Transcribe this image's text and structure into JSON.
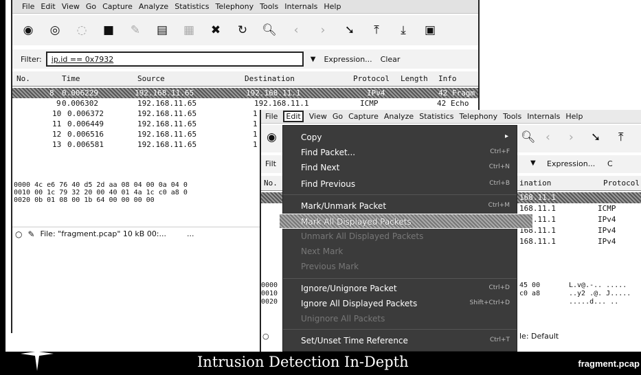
{
  "window1": {
    "menu": [
      "File",
      "Edit",
      "View",
      "Go",
      "Capture",
      "Analyze",
      "Statistics",
      "Telephony",
      "Tools",
      "Internals",
      "Help"
    ],
    "toolbar_icons": [
      "interface-icon",
      "start-capture-icon",
      "restart-icon",
      "stop-icon",
      "options-icon",
      "open-file-icon",
      "save-file-icon",
      "close-file-icon",
      "reload-icon",
      "find-icon",
      "go-back-icon",
      "go-forward-icon",
      "go-to-packet-icon",
      "first-packet-icon",
      "last-packet-icon",
      "colorize-icon"
    ],
    "filter": {
      "label": "Filter:",
      "value": "ip.id == 0x7932",
      "expression": "Expression...",
      "clear": "Clear"
    },
    "columns": [
      "No.",
      "Time",
      "Source",
      "Destination",
      "Protocol",
      "Length",
      "Info"
    ],
    "rows": [
      {
        "no": "8",
        "time": "0.006229",
        "source": "192.168.11.65",
        "dest": "192.168.11.1",
        "proto": "IPv4",
        "len": "42",
        "info": "Fragm"
      },
      {
        "no": "9",
        "time": "0.006302",
        "source": "192.168.11.65",
        "dest": "192.168.11.1",
        "proto": "ICMP",
        "len": "42",
        "info": "Echo"
      },
      {
        "no": "10",
        "time": "0.006372",
        "source": "192.168.11.65",
        "dest": "1",
        "proto": "",
        "len": "",
        "info": ""
      },
      {
        "no": "11",
        "time": "0.006449",
        "source": "192.168.11.65",
        "dest": "1",
        "proto": "",
        "len": "",
        "info": ""
      },
      {
        "no": "12",
        "time": "0.006516",
        "source": "192.168.11.65",
        "dest": "1",
        "proto": "",
        "len": "",
        "info": ""
      },
      {
        "no": "13",
        "time": "0.006581",
        "source": "192.168.11.65",
        "dest": "1",
        "proto": "",
        "len": "",
        "info": ""
      }
    ],
    "hex": [
      "0000  4c e6 76 40 d5 2d aa 08  04 00 0a 04 0",
      "0010  00 1c 79 32 20 00 40 01  4a 1c c0 a8 0",
      "0020  0b 01 08 00 1b 64 00 00  00 00"
    ],
    "status": "File: \"fragment.pcap\" 10 kB 00:...",
    "status_ellipsis": "..."
  },
  "window2": {
    "menu": [
      "File",
      "Edit",
      "View",
      "Go",
      "Capture",
      "Analyze",
      "Statistics",
      "Telephony",
      "Tools",
      "Internals",
      "Help"
    ],
    "filter_fragment": "Filt",
    "expression": "Expression...",
    "expr_tail": "C",
    "col_no": "No.",
    "col_dest": "ination",
    "col_proto": "Protocol",
    "rows": [
      {
        "dest": "168.11.1",
        "proto": ""
      },
      {
        "dest": "168.11.1",
        "proto": "ICMP"
      },
      {
        "dest": "168.11.1",
        "proto": "IPv4"
      },
      {
        "dest": "168.11.1",
        "proto": "IPv4"
      },
      {
        "dest": "168.11.1",
        "proto": "IPv4"
      }
    ],
    "hex": [
      {
        "off": "0000",
        "hex": "45 00",
        "ascii": "L.v@.-.. ....."
      },
      {
        "off": "0010",
        "hex": "c0 a8",
        "ascii": "..y2 .@. J....."
      },
      {
        "off": "0020",
        "hex": "",
        "ascii": ".....d... .."
      }
    ],
    "status_profile": "le: Default"
  },
  "edit_menu": {
    "items": [
      {
        "label": "Copy",
        "shortcut": "",
        "disabled": false,
        "submenu": true
      },
      {
        "label": "Find Packet...",
        "shortcut": "Ctrl+F",
        "disabled": false
      },
      {
        "label": "Find Next",
        "shortcut": "Ctrl+N",
        "disabled": false
      },
      {
        "label": "Find Previous",
        "shortcut": "Ctrl+B",
        "disabled": false
      },
      {
        "label": "Mark/Unmark Packet",
        "shortcut": "Ctrl+M",
        "disabled": false
      },
      {
        "label": "Mark All Displayed Packets",
        "shortcut": "",
        "disabled": false,
        "highlighted": true
      },
      {
        "label": "Unmark All Displayed Packets",
        "shortcut": "",
        "disabled": true
      },
      {
        "label": "Next Mark",
        "shortcut": "",
        "disabled": true
      },
      {
        "label": "Previous Mark",
        "shortcut": "",
        "disabled": true
      },
      {
        "label": "Ignore/Unignore Packet",
        "shortcut": "Ctrl+D",
        "disabled": false
      },
      {
        "label": "Ignore All Displayed Packets",
        "shortcut": "Shift+Ctrl+D",
        "disabled": false
      },
      {
        "label": "Unignore All Packets",
        "shortcut": "",
        "disabled": true
      },
      {
        "label": "Set/Unset Time Reference",
        "shortcut": "Ctrl+T",
        "disabled": false
      }
    ]
  },
  "banner": {
    "title": "Intrusion Detection In-Depth",
    "filename": "fragment.pcap"
  }
}
